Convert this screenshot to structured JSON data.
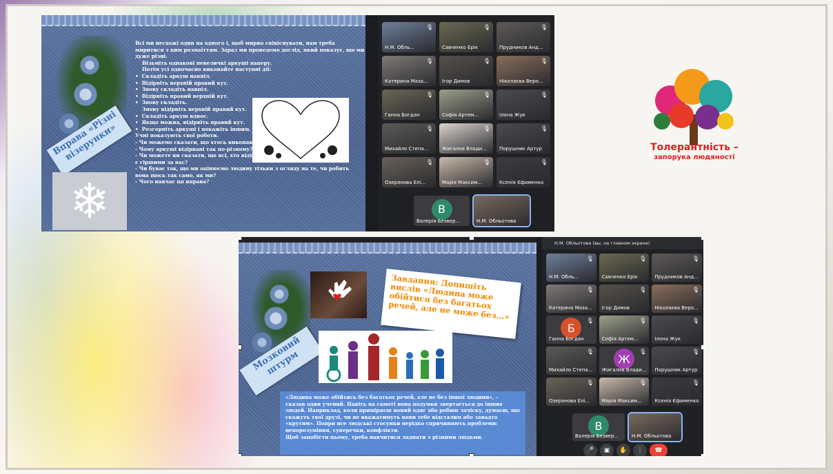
{
  "slide1": {
    "tag": "Вправа «Різні візерунки»",
    "lines": [
      "Всі ми несхожі один на одного і, щоб мирно співіснувати, нам треба",
      "миритися з цим розмаїттям. Зараз ми проведемо дослід, який показує, що ми",
      "дуже різні.",
      "    Візьміть однакові невеличкі аркуші паперу.",
      "    Потім усі одночасно виконайте наступні дії:",
      "•  Складіть аркуш навпіл.",
      "•  Відірвіть верхній правий кут.",
      "•  Знову складіть навпіл.",
      "•  Відірвіть правий верхній кут.",
      "•  Знову складіть.",
      "    Знову відірвіть верхній правий кут.",
      "•  Складіть аркуш вдвоє.",
      "•  Якщо можна, відірвіть правий кут.",
      "•  Розгорніть аркуші і покажіть іншим.",
      "Учні показують свої роботи.",
      "- Чи можемо сказати, що хтось виконав роботу неправильно?",
      "- Чому аркуші відірвані так по-різному?",
      "- Чи можете ви сказати, що всі, хто відірвав аркуші інакше, ніж ви,",
      "є гіршими за вас?",
      "- Чи буває так, що ми оцінюємо людину тільки з огляду на те, чи робить",
      "вона щось так само, як ми?",
      "- Чого навчає ця вправа?"
    ]
  },
  "call1": {
    "tiles": [
      {
        "name": "Н.М. Обль...",
        "color": "#6e7f9a"
      },
      {
        "name": "Савченко Ерік",
        "color": "#6b6a52"
      },
      {
        "name": "Прудников Анд...",
        "color": "#5e5a58"
      },
      {
        "name": "Катерина Маза...",
        "color": "#7f7a77"
      },
      {
        "name": "Ігор Димов",
        "color": "#55504a"
      },
      {
        "name": "Ніколаєва Веро...",
        "color": "#8a6e5c"
      },
      {
        "name": "Ганна Богдан",
        "color": "#6a6656"
      },
      {
        "name": "Софія Артем...",
        "color": "#9aa08a"
      },
      {
        "name": "Ілона Жук",
        "color": "#4a4a50"
      },
      {
        "name": "Михайло Степа...",
        "color": "#5c5a57"
      },
      {
        "name": "Жигалов Влади...",
        "color": "#dcd5cf"
      },
      {
        "name": "Порушник Артур",
        "color": "#4b4a4e"
      },
      {
        "name": "Озерянова Елі...",
        "color": "#6a6258"
      },
      {
        "name": "Марія Максим...",
        "color": "#c9b9aa"
      },
      {
        "name": "Ксенія Єфименко",
        "color": "#3c3c40"
      }
    ],
    "bottom": [
      {
        "name": "Валерія Безвер...",
        "initial": "В",
        "color": "#2f8a6a"
      },
      {
        "name": "Н.М. Обльотова",
        "color": "#7a6a5c"
      }
    ]
  },
  "slide2": {
    "tag": "Мозковий штурм",
    "task": "Завдання: Допишіть вислів «Людина може обійтися без багатьох речей, але не може без...»",
    "quote_lines": [
      "«Людина може обійтись без багатьох речей, але не без іншої людини», –",
      "сказав один учений. Навіть на самоті вона подумки звертається до інших",
      "людей. Наприклад, коли приміряєш новий одяг або робиш зачіску, думаєш, що",
      "скажуть твої друзі, чи не вважатимуть вони тебе відсталим або занадто",
      "«крутим». Попри все людські стосунки нерідко спричиняють проблеми:",
      "непорозуміння, суперечки, конфлікти.",
      "    Щоб запобігти цьому, треба навчитися ладнати з різними людьми."
    ]
  },
  "call2": {
    "header": "Н.М. Обльотова (вы, на главном экране)",
    "tiles": [
      {
        "name": "Н.М. Обль...",
        "color": "#6e7f9a"
      },
      {
        "name": "Савченко Ерік",
        "color": "#6b6a52"
      },
      {
        "name": "Прудников Анд...",
        "color": "#5e5a58"
      },
      {
        "name": "Катерина Маза...",
        "color": "#7f7a77"
      },
      {
        "name": "Ігор Димов",
        "color": "#55504a"
      },
      {
        "name": "Ніколаєва Веро...",
        "color": "#8a6e5c"
      },
      {
        "name": "Ганна Богдан",
        "initial": "Б",
        "color": "#d9502a"
      },
      {
        "name": "Софія Артем...",
        "color": "#9aa08a"
      },
      {
        "name": "Ілона Жук",
        "color": "#4a4a50"
      },
      {
        "name": "Михайло Степа...",
        "color": "#5c5a57"
      },
      {
        "name": "Жигалов Влади...",
        "initial": "Ж",
        "color": "#a23fb0"
      },
      {
        "name": "Порушник Артур",
        "color": "#4b4a4e"
      },
      {
        "name": "Озерянова Елі...",
        "color": "#6a6258"
      },
      {
        "name": "Марія Максим...",
        "color": "#c9b9aa"
      },
      {
        "name": "Ксенія Єфименко",
        "color": "#3c3c40"
      }
    ],
    "bottom": [
      {
        "name": "Валерія Безвер...",
        "initial": "В",
        "color": "#2f8a6a"
      },
      {
        "name": "Н.М. Обльотова",
        "color": "#7a6a5c"
      }
    ]
  },
  "logo": {
    "line1": "Толерантність –",
    "line2": "запорука людяності"
  },
  "colors": {
    "mic_off": "#ffffff",
    "end_call": "#ea4335",
    "highlight": "#8ab4f8"
  }
}
